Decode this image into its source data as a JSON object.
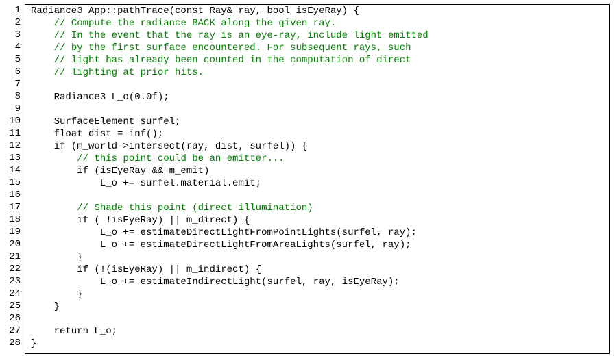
{
  "chart_data": {
    "type": "table",
    "title": "C++ code listing: App::pathTrace",
    "line_count": 28,
    "lines": [
      {
        "n": 1,
        "segments": [
          {
            "t": "Radiance3 App::pathTrace(const Ray& ray, bool isEyeRay) {",
            "c": "plain"
          }
        ]
      },
      {
        "n": 2,
        "segments": [
          {
            "t": "    ",
            "c": "plain"
          },
          {
            "t": "// Compute the radiance BACK along the given ray.",
            "c": "cmt"
          }
        ]
      },
      {
        "n": 3,
        "segments": [
          {
            "t": "    ",
            "c": "plain"
          },
          {
            "t": "// In the event that the ray is an eye-ray, include light emitted",
            "c": "cmt"
          }
        ]
      },
      {
        "n": 4,
        "segments": [
          {
            "t": "    ",
            "c": "plain"
          },
          {
            "t": "// by the first surface encountered. For subsequent rays, such",
            "c": "cmt"
          }
        ]
      },
      {
        "n": 5,
        "segments": [
          {
            "t": "    ",
            "c": "plain"
          },
          {
            "t": "// light has already been counted in the computation of direct",
            "c": "cmt"
          }
        ]
      },
      {
        "n": 6,
        "segments": [
          {
            "t": "    ",
            "c": "plain"
          },
          {
            "t": "// lighting at prior hits.",
            "c": "cmt"
          }
        ]
      },
      {
        "n": 7,
        "segments": [
          {
            "t": "",
            "c": "plain"
          }
        ]
      },
      {
        "n": 8,
        "segments": [
          {
            "t": "    Radiance3 L_o(0.0f);",
            "c": "plain"
          }
        ]
      },
      {
        "n": 9,
        "segments": [
          {
            "t": "",
            "c": "plain"
          }
        ]
      },
      {
        "n": 10,
        "segments": [
          {
            "t": "    SurfaceElement surfel;",
            "c": "plain"
          }
        ]
      },
      {
        "n": 11,
        "segments": [
          {
            "t": "    float dist = inf();",
            "c": "plain"
          }
        ]
      },
      {
        "n": 12,
        "segments": [
          {
            "t": "    if (m_world->intersect(ray, dist, surfel)) {",
            "c": "plain"
          }
        ]
      },
      {
        "n": 13,
        "segments": [
          {
            "t": "        ",
            "c": "plain"
          },
          {
            "t": "// this point could be an emitter...",
            "c": "cmt"
          }
        ]
      },
      {
        "n": 14,
        "segments": [
          {
            "t": "        if (isEyeRay && m_emit)",
            "c": "plain"
          }
        ]
      },
      {
        "n": 15,
        "segments": [
          {
            "t": "            L_o += surfel.material.emit;",
            "c": "plain"
          }
        ]
      },
      {
        "n": 16,
        "segments": [
          {
            "t": "",
            "c": "plain"
          }
        ]
      },
      {
        "n": 17,
        "segments": [
          {
            "t": "        ",
            "c": "plain"
          },
          {
            "t": "// Shade this point (direct illumination)",
            "c": "cmt"
          }
        ]
      },
      {
        "n": 18,
        "segments": [
          {
            "t": "        if ( !isEyeRay) || m_direct) {",
            "c": "plain"
          }
        ]
      },
      {
        "n": 19,
        "segments": [
          {
            "t": "            L_o += estimateDirectLightFromPointLights(surfel, ray);",
            "c": "plain"
          }
        ]
      },
      {
        "n": 20,
        "segments": [
          {
            "t": "            L_o += estimateDirectLightFromAreaLights(surfel, ray);",
            "c": "plain"
          }
        ]
      },
      {
        "n": 21,
        "segments": [
          {
            "t": "        }",
            "c": "plain"
          }
        ]
      },
      {
        "n": 22,
        "segments": [
          {
            "t": "        if (!(isEyeRay) || m_indirect) {",
            "c": "plain"
          }
        ]
      },
      {
        "n": 23,
        "segments": [
          {
            "t": "            L_o += estimateIndirectLight(surfel, ray, isEyeRay);",
            "c": "plain"
          }
        ]
      },
      {
        "n": 24,
        "segments": [
          {
            "t": "        }",
            "c": "plain"
          }
        ]
      },
      {
        "n": 25,
        "segments": [
          {
            "t": "    }",
            "c": "plain"
          }
        ]
      },
      {
        "n": 26,
        "segments": [
          {
            "t": "",
            "c": "plain"
          }
        ]
      },
      {
        "n": 27,
        "segments": [
          {
            "t": "    return L_o;",
            "c": "plain"
          }
        ]
      },
      {
        "n": 28,
        "segments": [
          {
            "t": "}",
            "c": "plain"
          }
        ]
      }
    ]
  }
}
